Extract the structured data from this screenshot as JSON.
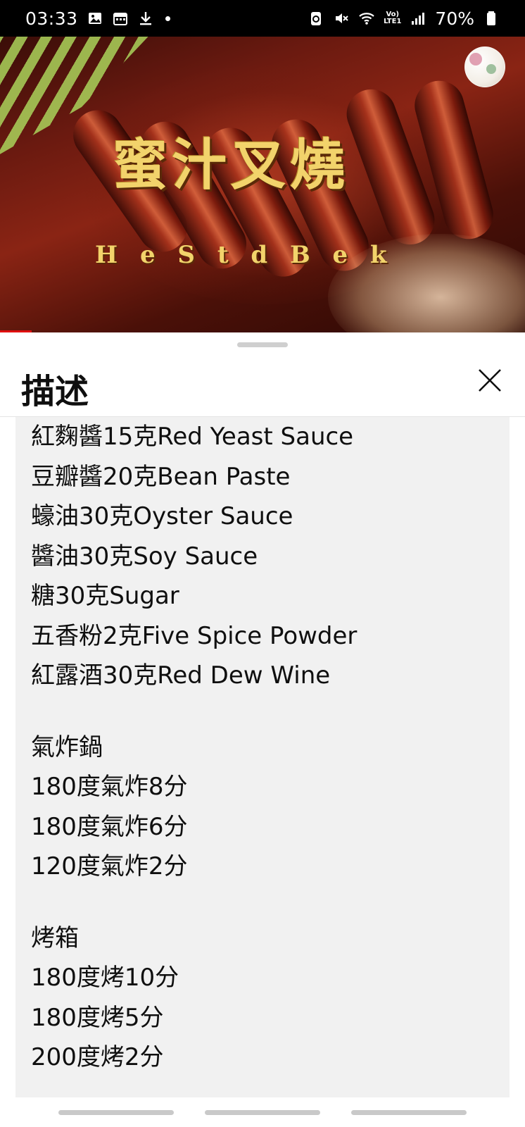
{
  "status_bar": {
    "time": "03:33",
    "volte_line1": "Vo)",
    "volte_line2": "LTE1",
    "battery": "70%",
    "icons": [
      "gallery-icon",
      "calendar-icon",
      "download-icon",
      "notification-dot",
      "nfc-icon",
      "mute-icon",
      "wifi-icon",
      "volte-icon",
      "signal-icon",
      "battery-icon"
    ]
  },
  "video": {
    "title": "蜜汁叉燒",
    "subtitle": "H e S t d B e k",
    "progress_percent": 6
  },
  "sheet": {
    "title": "描述",
    "close_icon": "close-icon",
    "lines_group1": [
      "紅麴醬15克Red Yeast Sauce",
      "豆瓣醬20克Bean Paste",
      "蠔油30克Oyster Sauce",
      "醬油30克Soy Sauce",
      "糖30克Sugar",
      "五香粉2克Five Spice Powder",
      "紅露酒30克Red Dew Wine"
    ],
    "lines_group2": [
      "氣炸鍋",
      "180度氣炸8分",
      "180度氣炸6分",
      "120度氣炸2分"
    ],
    "lines_group3": [
      "烤箱",
      "180度烤10分",
      "180度烤5分",
      "200度烤2分"
    ]
  }
}
